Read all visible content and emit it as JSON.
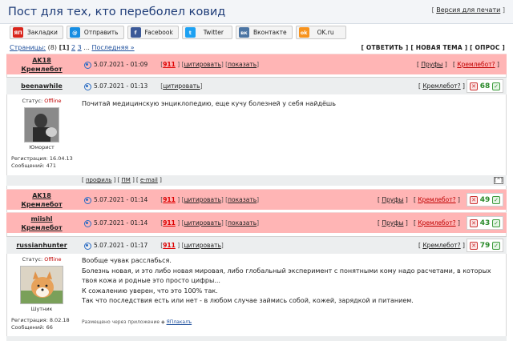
{
  "topic": {
    "title": "Пост для тех, кто переболел ковид",
    "print_version": "Версия для печати"
  },
  "share": [
    {
      "label": "Закладки",
      "icon": "yandex-bookmarks-icon",
      "icon_text": "ЯП",
      "color": "#d9251c"
    },
    {
      "label": "Отправить",
      "icon": "mail-icon",
      "icon_text": "@",
      "color": "#168de2"
    },
    {
      "label": "Facebook",
      "icon": "facebook-icon",
      "icon_text": "f",
      "color": "#3b5998"
    },
    {
      "label": "Twitter",
      "icon": "twitter-icon",
      "icon_text": "t",
      "color": "#1da1f2"
    },
    {
      "label": "Вконтакте",
      "icon": "vk-icon",
      "icon_text": "вк",
      "color": "#4c75a3"
    },
    {
      "label": "OK.ru",
      "icon": "odnoklassniki-icon",
      "icon_text": "ok",
      "color": "#f7931e"
    }
  ],
  "pagination": {
    "label": "Страницы:",
    "count": "(8)",
    "current": "[1]",
    "p2": "2",
    "p3": "3",
    "ellipsis": "...",
    "last": "Последняя »"
  },
  "actions": {
    "reply": "[ ОТВЕТИТЬ ]",
    "new_topic": "[ НОВАЯ ТЕМА ]",
    "poll": "[ ОПРОС ]"
  },
  "labels": {
    "quote": "цитировать",
    "show": "показать",
    "proofs": "Пруфы",
    "kremlebot_q": "Кремлебот?",
    "status": "Статус:",
    "offline": "Offline",
    "reg_label": "Регистрация:",
    "msgs_label": "Сообщений:",
    "profile": "профиль",
    "pm": "ПМ",
    "email": "e-mail",
    "top": "[^]",
    "via_app": "Размещено через приложение",
    "app_name": "ЯПлакалъ"
  },
  "posts": [
    {
      "author": "AK18",
      "rank": "Кремлебот",
      "date": "5.07.2021 - 01:09",
      "num": "911"
    },
    {
      "author": "beenawhile",
      "date": "5.07.2021 - 01:13",
      "rating": "68",
      "user_rank": "Юморист",
      "reg": "16.04.13",
      "msgs": "471",
      "text": "Почитай медицинскую энциклопедию, еще кучу болезней у себя найдёшь"
    },
    {
      "author": "AK18",
      "rank": "Кремлебот",
      "date": "5.07.2021 - 01:14",
      "num": "911",
      "rating": "49"
    },
    {
      "author": "miishl",
      "rank": "Кремлебот",
      "date": "5.07.2021 - 01:14",
      "num": "911",
      "rating": "43"
    },
    {
      "author": "russianhunter",
      "date": "5.07.2021 - 01:17",
      "num": "911",
      "rating": "79",
      "user_rank": "Шутник",
      "reg": "8.02.18",
      "msgs": "66",
      "lines": [
        "Вообще чувак расслабься.",
        "Болезнь новая, и это либо новая мировая, либо глобальный эксперимент с понятными кому надо расчетами, в которых",
        "твоя кожа и родные это просто цифры...",
        "К сожалению уверен, что это 100% так.",
        "Так что последствия есть или нет - в любом случае займись собой, кожей, зарядкой и питанием."
      ]
    }
  ]
}
